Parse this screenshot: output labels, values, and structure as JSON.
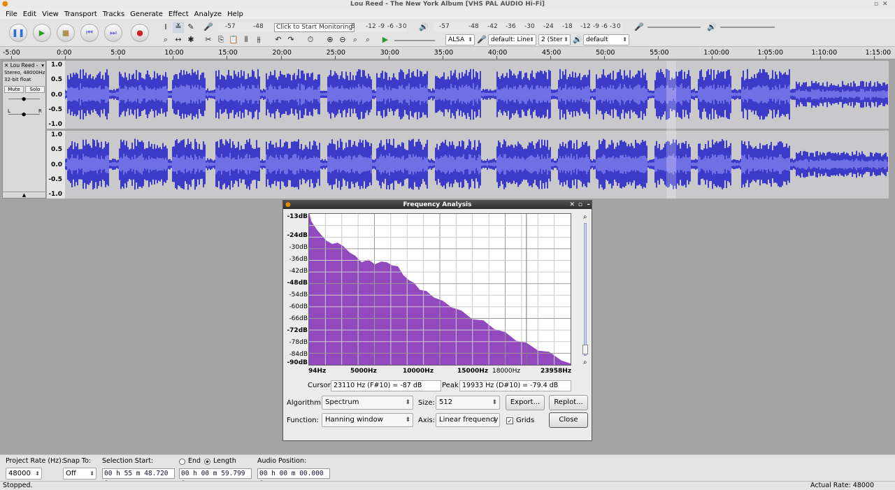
{
  "window": {
    "title": "Lou Reed - The New York Album [VHS PAL AUDIO Hi-Fi]"
  },
  "menu": [
    "File",
    "Edit",
    "View",
    "Transport",
    "Tracks",
    "Generate",
    "Effect",
    "Analyze",
    "Help"
  ],
  "meters": {
    "record_ticks": [
      "-57",
      "-48"
    ],
    "record_hint": "Click to Start Monitoring",
    "record_ticks_right": [
      "8",
      "-12",
      "-9",
      "-6",
      "-3",
      "0"
    ],
    "play_ticks": [
      "-57",
      "-48",
      "-42",
      "-36",
      "-30",
      "-24",
      "-18",
      "-12",
      "-9",
      "-6",
      "-3",
      "0"
    ]
  },
  "devices": {
    "host": "ALSA",
    "input": "default: Line",
    "channels": "2 (Ster",
    "output": "default"
  },
  "ruler": [
    "-5:00",
    "0:00",
    "5:00",
    "10:00",
    "15:00",
    "20:00",
    "25:00",
    "30:00",
    "35:00",
    "40:00",
    "45:00",
    "50:00",
    "55:00",
    "1:00:00",
    "1:05:00",
    "1:10:00",
    "1:15:00"
  ],
  "track": {
    "name": "Lou Reed -",
    "format": "Stereo, 48000Hz",
    "bitdepth": "32-bit float",
    "mute": "Mute",
    "solo": "Solo",
    "gain_l": "L",
    "gain_r": "R",
    "scale": [
      "1.0",
      "0.5",
      "0.0",
      "-0.5",
      "-1.0"
    ]
  },
  "dialog": {
    "title": "Frequency Analysis",
    "db_labels": [
      "-13dB",
      "-24dB",
      "-30dB",
      "-36dB",
      "-42dB",
      "-48dB",
      "-54dB",
      "-60dB",
      "-66dB",
      "-72dB",
      "-78dB",
      "-84dB",
      "-90dB"
    ],
    "hz_labels": [
      "94Hz",
      "5000Hz",
      "10000Hz",
      "15000Hz",
      "18000Hz",
      "23958Hz"
    ],
    "cursor_label": "Cursor:",
    "cursor_value": "23110 Hz (F#10) = -87 dB",
    "peak_label": "Peak:",
    "peak_value": "19933 Hz (D#10) = -79.4 dB",
    "algorithm_label": "Algorithm:",
    "algorithm": "Spectrum",
    "size_label": "Size:",
    "size": "512",
    "export": "Export...",
    "replot": "Replot...",
    "function_label": "Function:",
    "function": "Hanning window",
    "axis_label": "Axis:",
    "axis": "Linear frequency",
    "grids_label": "Grids",
    "close": "Close"
  },
  "chart_data": {
    "type": "area",
    "xlabel": "",
    "ylabel": "",
    "x_unit": "Hz",
    "y_unit": "dB",
    "xlim": [
      94,
      23958
    ],
    "ylim": [
      -90,
      -13
    ],
    "grid": true,
    "color": "#8a3ab9",
    "x": [
      94,
      300,
      600,
      900,
      1300,
      1700,
      2200,
      2700,
      3200,
      3800,
      4300,
      4900,
      5500,
      6100,
      6700,
      7200,
      7700,
      8200,
      8700,
      9200,
      9700,
      10200,
      10800,
      11500,
      12300,
      13100,
      14000,
      15000,
      16000,
      17000,
      18000,
      19000,
      19933,
      21000,
      22000,
      23110,
      23958
    ],
    "y": [
      -13,
      -16,
      -20,
      -21,
      -25,
      -26,
      -29,
      -27,
      -30,
      -32,
      -35,
      -37,
      -37,
      -38,
      -38,
      -37,
      -40,
      -39,
      -45,
      -46,
      -49,
      -51,
      -53,
      -55,
      -58,
      -60,
      -63,
      -66,
      -68,
      -71,
      -74,
      -77,
      -79.4,
      -82,
      -84,
      -87,
      -90
    ]
  },
  "selection": {
    "rate_label": "Project Rate (Hz):",
    "rate": "48000",
    "snap_label": "Snap To:",
    "snap": "Off",
    "start_label": "Selection Start:",
    "end_label": "End",
    "length_label": "Length",
    "start": "00 h 55 m 48.720 s",
    "length": "00 h 00 m 59.799 s",
    "pos_label": "Audio Position:",
    "pos": "00 h 00 m 00.000 s"
  },
  "status": {
    "left": "Stopped.",
    "right": "Actual Rate: 48000"
  }
}
